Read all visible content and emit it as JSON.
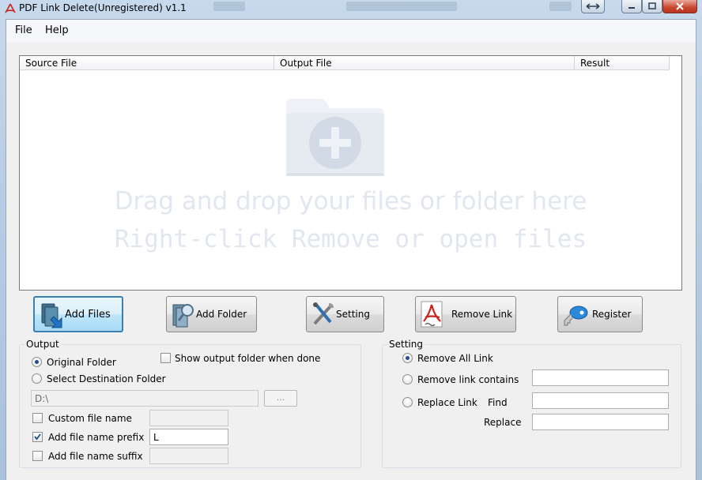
{
  "window": {
    "title": "PDF Link Delete(Unregistered) v1.1"
  },
  "menu": {
    "file": "File",
    "help": "Help"
  },
  "filelist": {
    "columns": [
      "Source File",
      "Output File",
      "Result"
    ],
    "drop_hint_1": "Drag and drop your files or folder here",
    "drop_hint_2": "Right-click Remove or open files"
  },
  "actions": {
    "add_files": "Add Files",
    "add_folder": "Add Folder",
    "setting": "Setting",
    "remove_link": "Remove Link",
    "register": "Register"
  },
  "output": {
    "title": "Output",
    "original_folder": "Original Folder",
    "select_destination": "Select Destination Folder",
    "show_output": "Show output folder when done",
    "destination_value": "D:\\",
    "browse_label": "...",
    "custom_name": "Custom file name",
    "custom_name_value": "",
    "prefix_label": "Add file name prefix",
    "prefix_value": "L",
    "suffix_label": "Add file name suffix",
    "suffix_value": "",
    "selected_mode": "Original Folder",
    "prefix_checked": true
  },
  "setting": {
    "title": "Setting",
    "remove_all": "Remove All Link",
    "remove_contains": "Remove link contains",
    "replace_link": "Replace Link",
    "find": "Find",
    "replace": "Replace",
    "remove_contains_value": "",
    "find_value": "",
    "replace_value": "",
    "selected_mode": "Remove All Link"
  },
  "colors": {
    "accent": "#3c7fb1",
    "pdf_red": "#c8231c",
    "drop_hint": "#e1e6ef"
  }
}
